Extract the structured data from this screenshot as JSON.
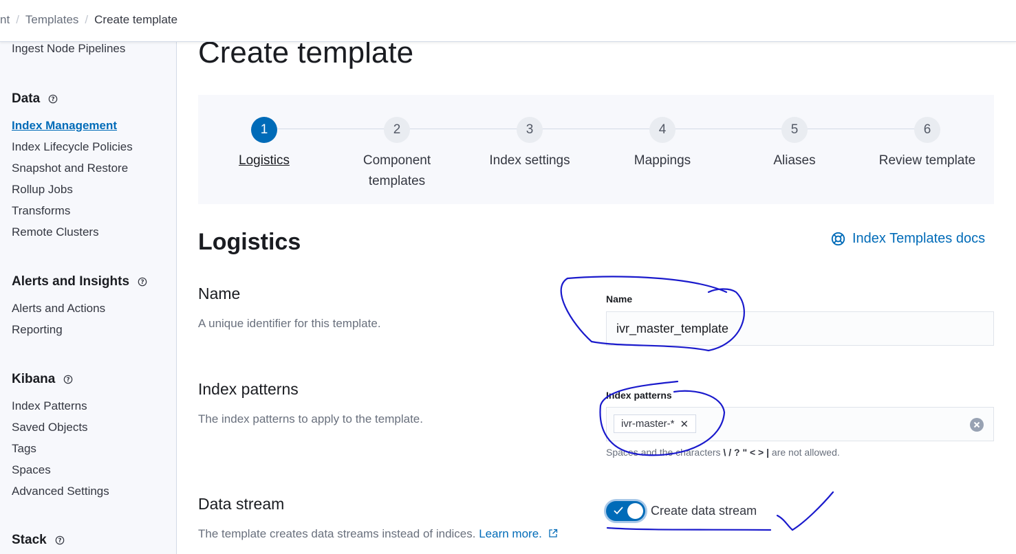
{
  "breadcrumb": {
    "items": [
      "nt",
      "Templates",
      "Create template"
    ]
  },
  "sidebar": {
    "top_item": "Ingest Node Pipelines",
    "sections": [
      {
        "heading": "Data",
        "items": [
          "Index Management",
          "Index Lifecycle Policies",
          "Snapshot and Restore",
          "Rollup Jobs",
          "Transforms",
          "Remote Clusters"
        ]
      },
      {
        "heading": "Alerts and Insights",
        "items": [
          "Alerts and Actions",
          "Reporting"
        ]
      },
      {
        "heading": "Kibana",
        "items": [
          "Index Patterns",
          "Saved Objects",
          "Tags",
          "Spaces",
          "Advanced Settings"
        ]
      },
      {
        "heading": "Stack",
        "items": []
      }
    ],
    "active_item": "Index Management"
  },
  "page": {
    "title": "Create template"
  },
  "steps": [
    {
      "number": "1",
      "title": "Logistics",
      "current": true
    },
    {
      "number": "2",
      "title": "Component templates",
      "current": false
    },
    {
      "number": "3",
      "title": "Index settings",
      "current": false
    },
    {
      "number": "4",
      "title": "Mappings",
      "current": false
    },
    {
      "number": "5",
      "title": "Aliases",
      "current": false
    },
    {
      "number": "6",
      "title": "Review template",
      "current": false
    }
  ],
  "logistics": {
    "title": "Logistics",
    "docs_link": "Index Templates docs",
    "docs_icon": "lifebuoy-icon",
    "name": {
      "title": "Name",
      "description": "A unique identifier for this template.",
      "label": "Name",
      "value": "ivr_master_template"
    },
    "index_patterns": {
      "title": "Index patterns",
      "description": "The index patterns to apply to the template.",
      "label": "Index patterns",
      "pill": "ivr-master-*",
      "help_prefix": "Spaces and the characters",
      "help_chars": "\\ / ? \" < > |",
      "help_suffix": "are not allowed."
    },
    "data_stream": {
      "title": "Data stream",
      "description": "The template creates data streams instead of indices.",
      "learn_more": "Learn more.",
      "switch_label": "Create data stream",
      "enabled": true
    }
  },
  "colors": {
    "accent": "#006bb8",
    "annotation_ink": "#1a1acc"
  }
}
